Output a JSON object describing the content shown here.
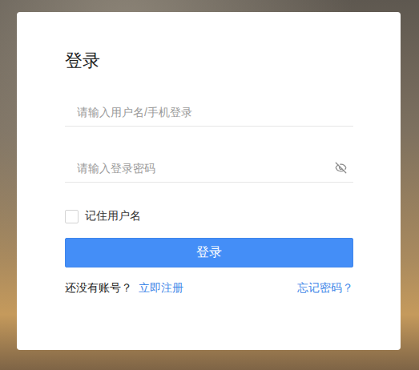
{
  "login": {
    "title": "登录",
    "fields": [
      {
        "kind": "text",
        "placeholder": "请输入用户名/手机登录"
      },
      {
        "kind": "password",
        "placeholder": "请输入登录密码"
      }
    ],
    "remember": {
      "label": "记住用户名",
      "checked": false
    },
    "button": "登录",
    "footer": {
      "prompt": "还没有账号？",
      "register": "立即注册",
      "forgot": "忘记密码？"
    }
  }
}
